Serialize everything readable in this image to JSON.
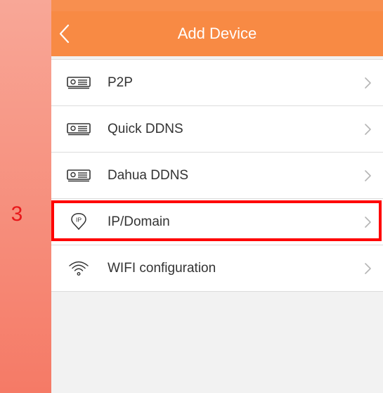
{
  "annotation": {
    "step_number": "3",
    "highlight_color": "#ff0000"
  },
  "header": {
    "title": "Add Device",
    "back_icon": "chevron-left-icon",
    "background_color": "#f88a44"
  },
  "menu": {
    "items": [
      {
        "label": "P2P",
        "icon": "dvr-device-icon"
      },
      {
        "label": "Quick DDNS",
        "icon": "dvr-device-icon"
      },
      {
        "label": "Dahua DDNS",
        "icon": "dvr-device-icon"
      },
      {
        "label": "IP/Domain",
        "icon": "ip-location-icon",
        "highlighted": true
      },
      {
        "label": "WIFI configuration",
        "icon": "wifi-icon"
      }
    ],
    "chevron_icon": "chevron-right-icon"
  }
}
